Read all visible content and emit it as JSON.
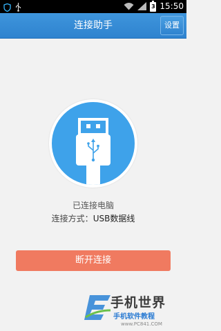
{
  "status_bar": {
    "time": "15:50",
    "battery_level": "3",
    "icons": [
      "shield-icon",
      "usb-icon",
      "wifi-icon",
      "signal-icon",
      "battery-icon"
    ]
  },
  "header": {
    "title": "连接助手",
    "settings_label": "设置"
  },
  "usb_graphic": {
    "icon": "usb-plug-icon"
  },
  "connection": {
    "status_text": "已连接电脑",
    "mode_label": "连接方式：",
    "mode_value": "USB数据线"
  },
  "actions": {
    "disconnect_label": "断开连接"
  },
  "watermark": {
    "brand": "手机世界",
    "subtitle": "手机软件教程",
    "url": "www.PC841.COM"
  },
  "colors": {
    "header": "#2f83cf",
    "usb_circle": "#3ea2ea",
    "disconnect_button": "#f07a60",
    "background": "#f2f2f2"
  }
}
